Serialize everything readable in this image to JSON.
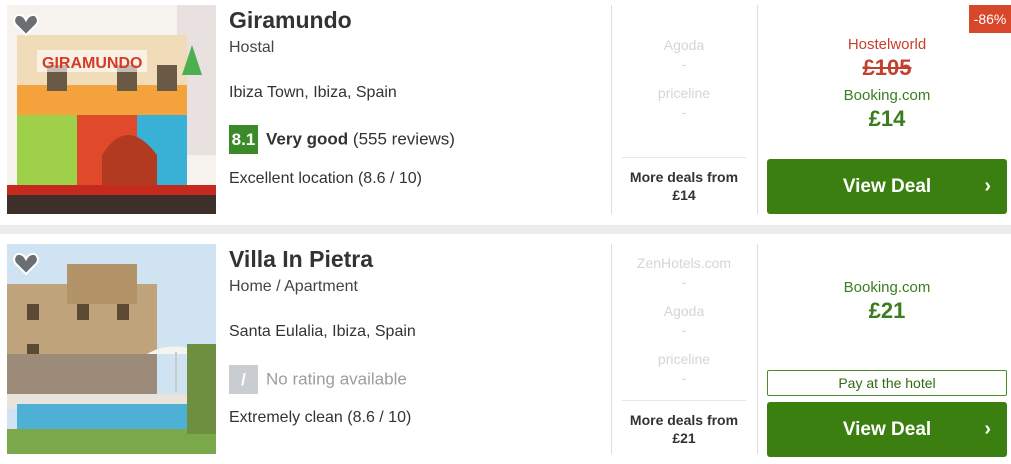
{
  "listings": [
    {
      "name": "Giramundo",
      "type": "Hostal",
      "location": "Ibiza Town, Ibiza, Spain",
      "rating_score": "8.1",
      "rating_label": "Very good",
      "rating_count": "(555 reviews)",
      "extra": "Excellent location (8.6 / 10)",
      "providers": [
        "Agoda",
        "priceline"
      ],
      "dash": "-",
      "more_deals_label": "More deals from",
      "more_deals_price": "£14",
      "discount": "-86%",
      "old_site": "Hostelworld",
      "old_price": "£105",
      "site": "Booking.com",
      "price": "£14",
      "cta": "View Deal",
      "chevron": "›"
    },
    {
      "name": "Villa In Pietra",
      "type": "Home / Apartment",
      "location": "Santa Eulalia, Ibiza, Spain",
      "rating_score": "/",
      "rating_none": "No rating available",
      "extra": "Extremely clean (8.6 / 10)",
      "providers": [
        "ZenHotels.com",
        "Agoda",
        "priceline"
      ],
      "dash": "-",
      "more_deals_label": "More deals from",
      "more_deals_price": "£21",
      "site": "Booking.com",
      "price": "£21",
      "pay_at_hotel": "Pay at the hotel",
      "cta": "View Deal",
      "chevron": "›"
    }
  ],
  "colors": {
    "deal_button": "#3b7f11",
    "price_green": "#3a7d1e",
    "strike_red": "#c4402e",
    "score_green": "#3a8a2a",
    "discount_badge": "#d9472b"
  },
  "icons": {
    "favorite": "heart-icon",
    "cta_arrow": "chevron-right-icon"
  }
}
